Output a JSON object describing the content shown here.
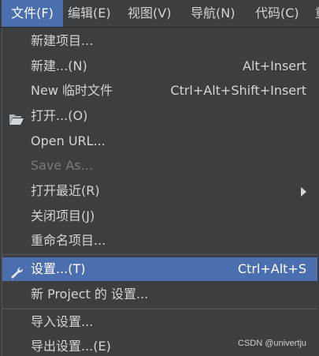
{
  "menubar": {
    "items": [
      {
        "label": "文件(F)"
      },
      {
        "label": "编辑(E)"
      },
      {
        "label": "视图(V)"
      },
      {
        "label": "导航(N)"
      },
      {
        "label": "代码(C)"
      },
      {
        "label": "重"
      }
    ]
  },
  "file_menu": {
    "items": [
      {
        "label": "新建项目..."
      },
      {
        "label": "新建...(N)",
        "shortcut": "Alt+Insert"
      },
      {
        "label": "New 临时文件",
        "shortcut": "Ctrl+Alt+Shift+Insert"
      },
      {
        "label": "打开...(O)",
        "icon": "folder-open-icon"
      },
      {
        "label": "Open URL..."
      },
      {
        "label": "Save As...",
        "disabled": true
      },
      {
        "label": "打开最近(R)",
        "submenu": true
      },
      {
        "label": "关闭项目(J)"
      },
      {
        "label": "重命名项目..."
      },
      {
        "label": "设置...(T)",
        "shortcut": "Ctrl+Alt+S",
        "icon": "wrench-icon",
        "selected": true
      },
      {
        "label": "新 Project 的 设置..."
      },
      {
        "label": "导入设置..."
      },
      {
        "label": "导出设置...(E)"
      }
    ]
  },
  "watermark": "CSDN @univertju",
  "colors": {
    "background": "#3c3f41",
    "selection": "#4b6eaf",
    "text": "#d4d4d4",
    "disabled_text": "#7a7a7a"
  }
}
